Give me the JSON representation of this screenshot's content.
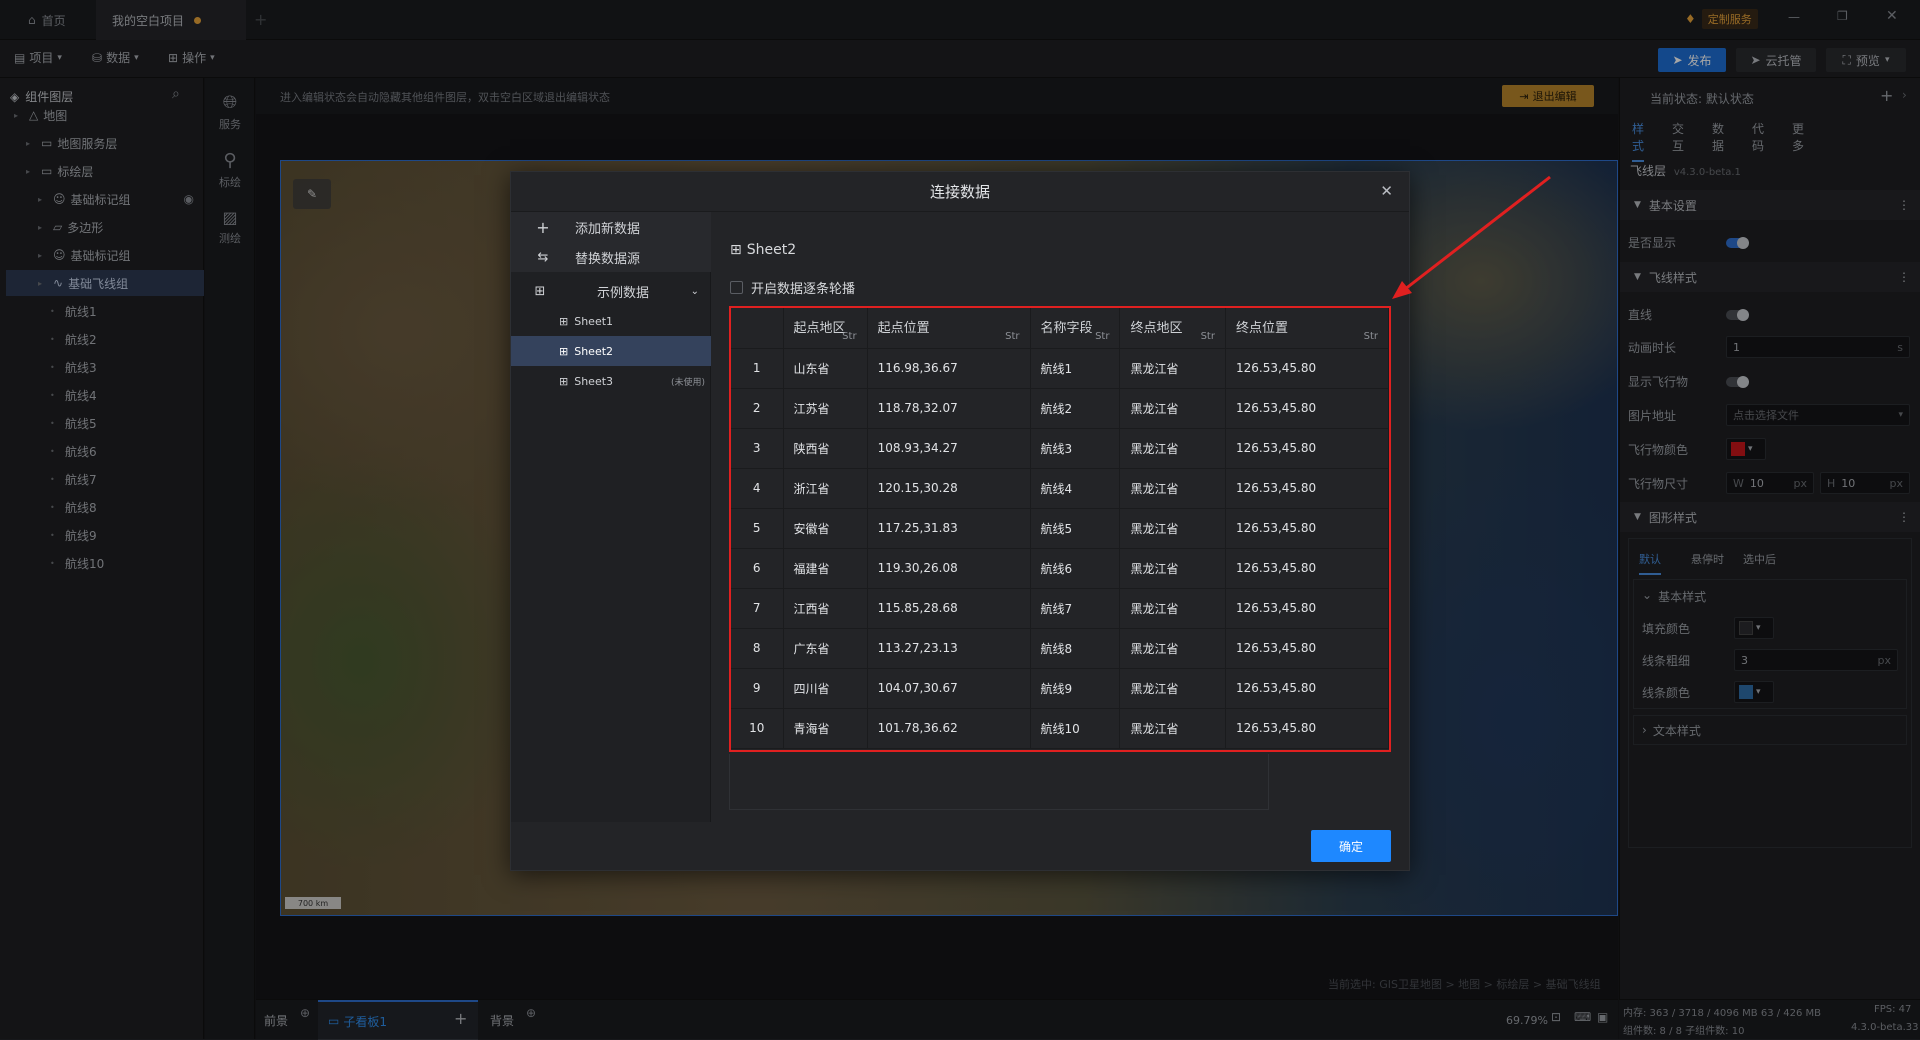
{
  "titlebar": {
    "home_tab": "首页",
    "project_tab": "我的空白项目",
    "custom_service": "定制服务"
  },
  "menubar": {
    "project": "项目",
    "data": "数据",
    "operate": "操作",
    "publish": "发布",
    "cloud": "云托管",
    "preview": "预览"
  },
  "layers": {
    "title": "组件图层",
    "items": [
      {
        "label": "地图",
        "indent": 0
      },
      {
        "label": "地图服务层",
        "indent": 1
      },
      {
        "label": "标绘层",
        "indent": 1
      },
      {
        "label": "基础标记组",
        "indent": 2
      },
      {
        "label": "多边形",
        "indent": 2
      },
      {
        "label": "基础标记组",
        "indent": 2
      },
      {
        "label": "基础飞线组",
        "indent": 2
      },
      {
        "label": "航线1",
        "indent": 3
      },
      {
        "label": "航线2",
        "indent": 3
      },
      {
        "label": "航线3",
        "indent": 3
      },
      {
        "label": "航线4",
        "indent": 3
      },
      {
        "label": "航线5",
        "indent": 3
      },
      {
        "label": "航线6",
        "indent": 3
      },
      {
        "label": "航线7",
        "indent": 3
      },
      {
        "label": "航线8",
        "indent": 3
      },
      {
        "label": "航线9",
        "indent": 3
      },
      {
        "label": "航线10",
        "indent": 3
      }
    ],
    "selected_index": 6
  },
  "strip": {
    "service": "服务",
    "mark": "标绘",
    "measure": "测绘"
  },
  "canvas": {
    "hint": "进入编辑状态会自动隐藏其他组件图层，双击空白区域退出编辑状态",
    "exit_edit": "退出编辑",
    "scale_label": "700 km",
    "breadcrumb": "当前选中: GIS卫星地图 > 地图 > 标绘层 > 基础飞线组"
  },
  "bottombar": {
    "front": "前景",
    "sub_board": "子看板1",
    "background": "背景",
    "zoom": "69.79%"
  },
  "rightpanel": {
    "state_label": "当前状态: 默认状态",
    "tabs": [
      "样式",
      "交互",
      "数据",
      "代码",
      "更多"
    ],
    "component_name": "飞线层",
    "version": "v4.3.0-beta.1",
    "basic_settings": "基本设置",
    "visible_label": "是否显示",
    "flyline_style": "飞线样式",
    "straight_label": "直线",
    "duration_label": "动画时长",
    "duration_value": "1",
    "duration_unit": "s",
    "show_flyer_label": "显示飞行物",
    "image_label": "图片地址",
    "image_placeholder": "点击选择文件",
    "flyer_color_label": "飞行物颜色",
    "flyer_color": "#c8161b",
    "flyer_size_label": "飞行物尺寸",
    "w_label": "W",
    "w_value": "10",
    "h_label": "H",
    "h_value": "10",
    "px": "px",
    "shape_style": "图形样式",
    "shape_tabs": [
      "默认",
      "悬停时",
      "选中后"
    ],
    "basic_style": "基本样式",
    "fill_color_label": "填充颜色",
    "fill_color": "#2b2c30",
    "line_width_label": "线条粗细",
    "line_width_value": "3",
    "line_color_label": "线条颜色",
    "line_color": "#2f6ea8",
    "text_style": "文本样式"
  },
  "status": {
    "memory": "内存: 363 / 3718 / 4096 MB 63 / 426 MB",
    "fps": "FPS: 47",
    "components": "组件数: 8 / 8  子组件数: 10",
    "version": "4.3.0-beta.33"
  },
  "dialog": {
    "title": "连接数据",
    "add_data": "添加新数据",
    "replace_source": "替换数据源",
    "example_data": "示例数据",
    "sheets": [
      "Sheet1",
      "Sheet2",
      "Sheet3"
    ],
    "unused": "(未使用)",
    "current_sheet": "Sheet2",
    "carousel_label": "开启数据逐条轮播",
    "confirm": "确定",
    "columns": [
      "起点地区",
      "起点位置",
      "名称字段",
      "终点地区",
      "终点位置"
    ],
    "type_symbol": "Str",
    "rows": [
      [
        "1",
        "山东省",
        "116.98,36.67",
        "航线1",
        "黑龙江省",
        "126.53,45.80"
      ],
      [
        "2",
        "江苏省",
        "118.78,32.07",
        "航线2",
        "黑龙江省",
        "126.53,45.80"
      ],
      [
        "3",
        "陕西省",
        "108.93,34.27",
        "航线3",
        "黑龙江省",
        "126.53,45.80"
      ],
      [
        "4",
        "浙江省",
        "120.15,30.28",
        "航线4",
        "黑龙江省",
        "126.53,45.80"
      ],
      [
        "5",
        "安徽省",
        "117.25,31.83",
        "航线5",
        "黑龙江省",
        "126.53,45.80"
      ],
      [
        "6",
        "福建省",
        "119.30,26.08",
        "航线6",
        "黑龙江省",
        "126.53,45.80"
      ],
      [
        "7",
        "江西省",
        "115.85,28.68",
        "航线7",
        "黑龙江省",
        "126.53,45.80"
      ],
      [
        "8",
        "广东省",
        "113.27,23.13",
        "航线8",
        "黑龙江省",
        "126.53,45.80"
      ],
      [
        "9",
        "四川省",
        "104.07,30.67",
        "航线9",
        "黑龙江省",
        "126.53,45.80"
      ],
      [
        "10",
        "青海省",
        "101.78,36.62",
        "航线10",
        "黑龙江省",
        "126.53,45.80"
      ]
    ]
  },
  "colors": {
    "accent": "#1e88ff",
    "highlight": "#e02020",
    "selected": "#34425c"
  }
}
